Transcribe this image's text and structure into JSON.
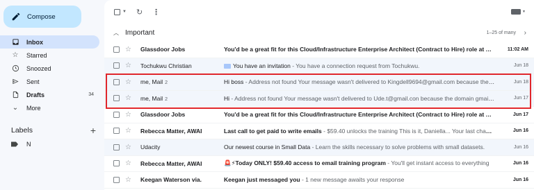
{
  "sidebar": {
    "compose_label": "Compose",
    "items": [
      {
        "label": "Inbox",
        "icon": "inbox-icon",
        "count": ""
      },
      {
        "label": "Starred",
        "icon": "star-icon",
        "count": ""
      },
      {
        "label": "Snoozed",
        "icon": "clock-icon",
        "count": ""
      },
      {
        "label": "Sent",
        "icon": "send-icon",
        "count": ""
      },
      {
        "label": "Drafts",
        "icon": "draft-icon",
        "count": "34"
      },
      {
        "label": "More",
        "icon": "chevron-down-icon",
        "count": ""
      }
    ],
    "labels_heading": "Labels",
    "labels": [
      {
        "label": "N",
        "icon": "label-icon"
      }
    ]
  },
  "section": {
    "title": "Important",
    "range": "1–25 of many"
  },
  "emails": [
    {
      "sender": "Glassdoor Jobs",
      "count": "",
      "subject": "You'd be a great fit for this Cloud/Infrastructure Enterprise Architect (Contract to Hire) role at Yahoo.",
      "snippet": "",
      "date": "11:02 AM",
      "unread": true
    },
    {
      "sender": "Tochukwu Christian",
      "count": "",
      "subject": "You have an invitation",
      "snippet": " - You have a connection request from Tochukwu.",
      "date": "Jun 18",
      "unread": false
    },
    {
      "sender": "me, Mail",
      "count": "2",
      "subject": "Hi boss",
      "snippet": " - Address not found Your message wasn't delivered to Kingdell9694@gmail.com because the address couldn't be found",
      "date": "Jun 18",
      "unread": false
    },
    {
      "sender": "me, Mail",
      "count": "2",
      "subject": "Hi",
      "snippet": " - Address not found Your message wasn't delivered to Ude.t@gmail.con because the domain gmail.con couldn't be found",
      "date": "Jun 17",
      "unread": false
    },
    {
      "sender": "Glassdoor Jobs",
      "count": "",
      "subject": "You'd be a great fit for this Cloud/Infrastructure Enterprise Architect (Contract to Hire) role at Yahoo.",
      "snippet": "",
      "date": "Jun 17",
      "unread": true
    },
    {
      "sender": "Rebecca Matter, AWAI",
      "count": "",
      "subject": "Last call to get paid to write emails",
      "snippet": " - $59.40 unlocks the training This is it, Daniella... Your last chance",
      "date": "Jun 16",
      "unread": true
    },
    {
      "sender": "Udacity",
      "count": "",
      "subject": "Our newest course in Small Data",
      "snippet": " - Learn the skills necessary to solve problems with small datasets.",
      "date": "Jun 16",
      "unread": false
    },
    {
      "sender": "Rebecca Matter, AWAI",
      "count": "",
      "subject": "🚨⚡Today ONLY! $59.40 access to email training program",
      "snippet": " - You'll get instant access to everything",
      "date": "Jun 16",
      "unread": true
    },
    {
      "sender": "Keegan Waterson via.",
      "count": "",
      "subject": "Keegan just messaged you",
      "snippet": " - 1 new message awaits your response",
      "date": "Jun 16",
      "unread": true
    }
  ],
  "colors": {
    "highlight": "#e0262b",
    "compose_bg": "#c2e7ff",
    "active_nav": "#d3e3fd"
  }
}
